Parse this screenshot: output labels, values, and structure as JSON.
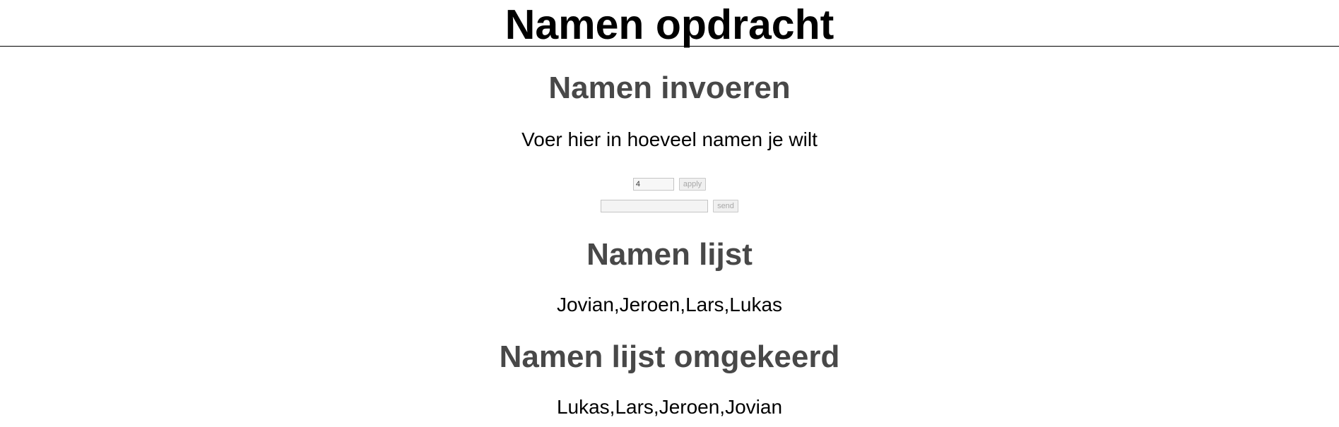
{
  "page": {
    "title": "Namen opdracht"
  },
  "input_section": {
    "heading": "Namen invoeren",
    "instruction": "Voer hier in hoeveel namen je wilt",
    "count_value": "4",
    "apply_label": "apply",
    "name_value": "",
    "send_label": "send"
  },
  "list_section": {
    "heading": "Namen lijst",
    "names": "Jovian,Jeroen,Lars,Lukas"
  },
  "reversed_section": {
    "heading": "Namen lijst omgekeerd",
    "names": "Lukas,Lars,Jeroen,Jovian"
  }
}
